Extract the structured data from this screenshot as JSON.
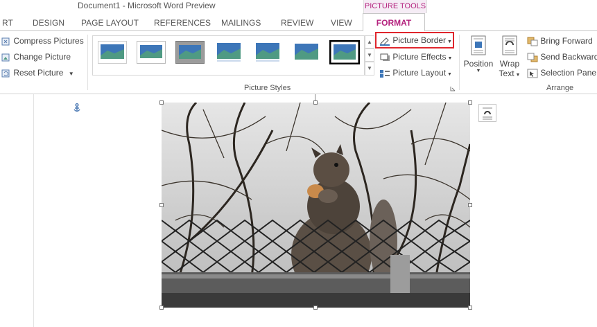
{
  "window": {
    "title": "Document1 - Microsoft Word Preview"
  },
  "context_tab": {
    "label": "PICTURE TOOLS"
  },
  "tabs": [
    {
      "label": "RT"
    },
    {
      "label": "DESIGN"
    },
    {
      "label": "PAGE LAYOUT"
    },
    {
      "label": "REFERENCES"
    },
    {
      "label": "MAILINGS"
    },
    {
      "label": "REVIEW"
    },
    {
      "label": "VIEW"
    },
    {
      "label": "FORMAT"
    }
  ],
  "adjust": {
    "compress": "Compress Pictures",
    "change": "Change Picture",
    "reset": "Reset Picture"
  },
  "picture_styles": {
    "group_label": "Picture Styles",
    "border": "Picture Border",
    "effects": "Picture Effects",
    "layout": "Picture Layout"
  },
  "arrange": {
    "group_label": "Arrange",
    "position": "Position",
    "wrap_line1": "Wrap",
    "wrap_line2": "Text",
    "bring_forward": "Bring Forward",
    "send_backward": "Send Backward",
    "selection_pane": "Selection Pane"
  },
  "colors": {
    "accent": "#b4227e",
    "highlight": "#e0252c",
    "thumb_sky": "#3d76b8",
    "thumb_hill": "#4f9a83"
  }
}
